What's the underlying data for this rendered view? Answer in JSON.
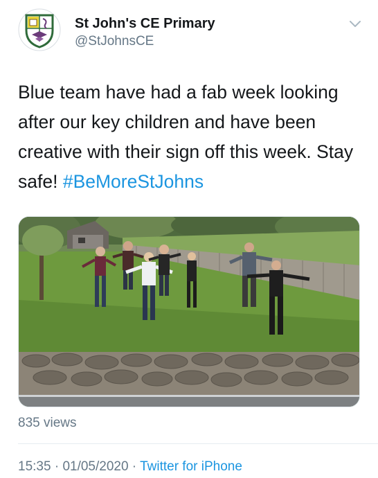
{
  "author": {
    "display_name": "St John's CE Primary",
    "handle": "@StJohnsCE",
    "avatar_icon": "school-crest-icon"
  },
  "menu_icon": "chevron-down-icon",
  "tweet": {
    "text": "Blue team have had a fab week looking after our key children and have been creative with their sign off this week.  Stay safe! ",
    "hashtag": "#BeMoreStJohns"
  },
  "media": {
    "type": "video",
    "icon": "video-thumbnail"
  },
  "stats": {
    "views": "835 views"
  },
  "meta": {
    "time": "15:35",
    "date": "01/05/2020",
    "separator": " · ",
    "source": "Twitter for iPhone"
  },
  "colors": {
    "link": "#1b95e0",
    "secondary_text": "#657786",
    "primary_text": "#14171a"
  }
}
